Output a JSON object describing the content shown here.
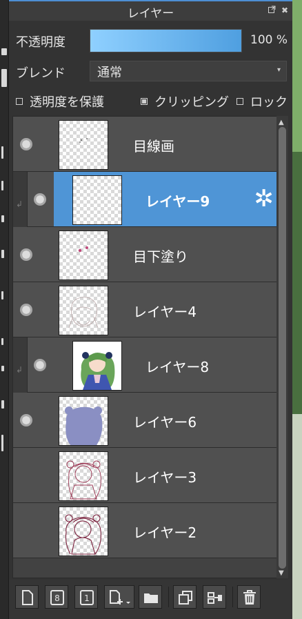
{
  "panel": {
    "title": "レイヤー",
    "title_buttons": [
      "pop-out-icon",
      "close-icon"
    ],
    "close_glyph": "✖"
  },
  "opacity": {
    "label": "不透明度",
    "value": "100 %",
    "fraction": 1.0
  },
  "blend": {
    "label": "ブレンド",
    "value": "通常"
  },
  "options": [
    {
      "label": "透明度を保護",
      "checked": false
    },
    {
      "label": "クリッピング",
      "checked": true
    },
    {
      "label": "ロック",
      "checked": false
    }
  ],
  "layers": [
    {
      "name": "目線画",
      "visible": true,
      "clipped": false,
      "selected": false,
      "thumb": "sketch-light"
    },
    {
      "name": "レイヤー9",
      "visible": true,
      "clipped": true,
      "selected": true,
      "thumb": "empty"
    },
    {
      "name": "目下塗り",
      "visible": true,
      "clipped": false,
      "selected": false,
      "thumb": "pink-dots"
    },
    {
      "name": "レイヤー4",
      "visible": true,
      "clipped": false,
      "selected": false,
      "thumb": "lineart-faint"
    },
    {
      "name": "レイヤー8",
      "visible": true,
      "clipped": true,
      "selected": false,
      "thumb": "color-character"
    },
    {
      "name": "レイヤー6",
      "visible": true,
      "clipped": false,
      "selected": false,
      "thumb": "silhouette"
    },
    {
      "name": "レイヤー3",
      "visible": false,
      "clipped": false,
      "selected": false,
      "thumb": "lineart-red"
    },
    {
      "name": "レイヤー2",
      "visible": false,
      "clipped": false,
      "selected": false,
      "thumb": "lineart-dark"
    }
  ],
  "bottom_buttons": [
    {
      "name": "new-layer-icon"
    },
    {
      "name": "new-8bit-layer-icon",
      "label": "8"
    },
    {
      "name": "new-1bit-layer-icon",
      "label": "1"
    },
    {
      "name": "add-layer-menu-icon"
    },
    {
      "name": "new-folder-icon"
    },
    {
      "name": "duplicate-layer-icon"
    },
    {
      "name": "merge-layer-icon"
    },
    {
      "name": "delete-layer-icon"
    }
  ],
  "colors": {
    "accent": "#4f95d6",
    "opacity_fill": "#5aa8e8",
    "selected_row": "#4f95d6"
  }
}
